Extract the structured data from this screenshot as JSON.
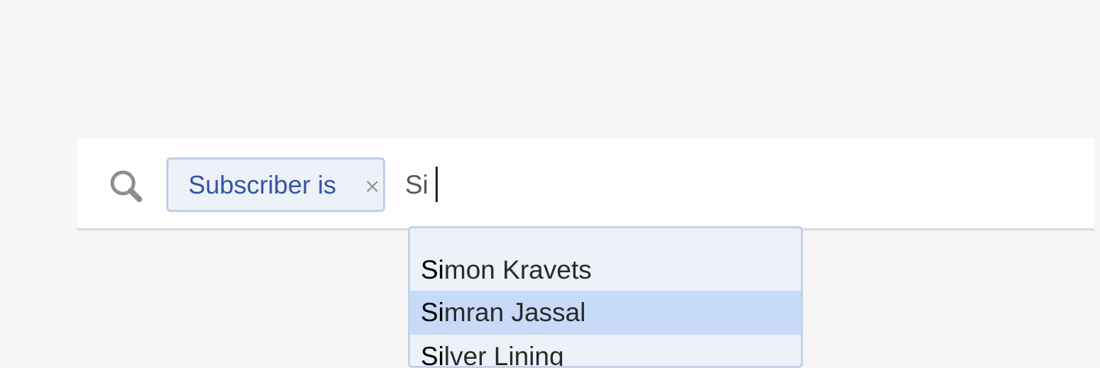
{
  "search": {
    "icon": "search-icon",
    "query": "Si"
  },
  "filter_chip": {
    "label": "Subscriber is",
    "close_icon": "close-icon"
  },
  "suggestions": {
    "highlighted_index": 1,
    "items": [
      {
        "match": "Si",
        "rest": "mon Kravets"
      },
      {
        "match": "Si",
        "rest": "mran Jassal"
      },
      {
        "match": "Si",
        "rest": "lver Lining"
      }
    ]
  },
  "colors": {
    "chip_text": "#3454a4",
    "chip_bg": "#edf1f8",
    "highlight_bg": "#c7dbf8"
  }
}
